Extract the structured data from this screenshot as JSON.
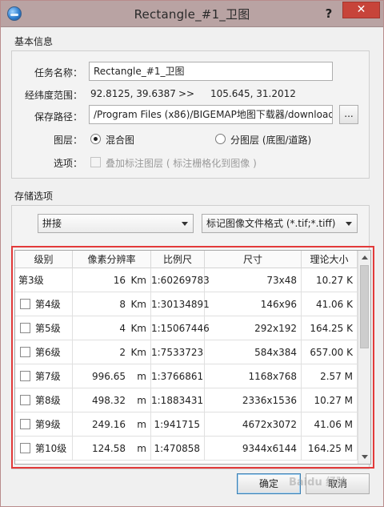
{
  "window": {
    "title": "Rectangle_#1_卫图",
    "help_label": "?",
    "close_label": "✕",
    "icon": "globe-icon"
  },
  "basic_info": {
    "section_label": "基本信息",
    "task_name_label": "任务名称：",
    "task_name_value": "Rectangle_#1_卫图",
    "range_label": "经纬度范围：",
    "range_from": "92.8125, 39.6387",
    "range_arrow": ">>",
    "range_to": "105.645, 31.2012",
    "save_path_label": "保存路径：",
    "save_path_value": "/Program Files (x86)/BIGEMAP地图下载器/download",
    "browse_label": "...",
    "layer_label": "图层：",
    "layer_option_1": "混合图",
    "layer_option_2": "分图层 (底图/道路)",
    "layer_selected": "混合图",
    "options_label": "选项：",
    "overlay_option": "叠加标注图层 ( 标注栅格化到图像 )"
  },
  "storage": {
    "section_label": "存储选项",
    "mode_select": "拼接",
    "format_select": "标记图像文件格式 (*.tif;*.tiff)"
  },
  "table": {
    "headers": [
      "级别",
      "像素分辨率",
      "比例尺",
      "尺寸",
      "理论大小"
    ],
    "rows": [
      {
        "level": "第3级",
        "has_checkbox": false,
        "res_value": "16",
        "res_unit": "Km",
        "scale": "1:60269783",
        "size": "73x48",
        "theory": "10.27 K"
      },
      {
        "level": "第4级",
        "has_checkbox": true,
        "res_value": "8",
        "res_unit": "Km",
        "scale": "1:30134891",
        "size": "146x96",
        "theory": "41.06 K"
      },
      {
        "level": "第5级",
        "has_checkbox": true,
        "res_value": "4",
        "res_unit": "Km",
        "scale": "1:15067446",
        "size": "292x192",
        "theory": "164.25 K"
      },
      {
        "level": "第6级",
        "has_checkbox": true,
        "res_value": "2",
        "res_unit": "Km",
        "scale": "1:7533723",
        "size": "584x384",
        "theory": "657.00 K"
      },
      {
        "level": "第7级",
        "has_checkbox": true,
        "res_value": "996.65",
        "res_unit": "m",
        "scale": "1:3766861",
        "size": "1168x768",
        "theory": "2.57 M"
      },
      {
        "level": "第8级",
        "has_checkbox": true,
        "res_value": "498.32",
        "res_unit": "m",
        "scale": "1:1883431",
        "size": "2336x1536",
        "theory": "10.27 M"
      },
      {
        "level": "第9级",
        "has_checkbox": true,
        "res_value": "249.16",
        "res_unit": "m",
        "scale": "1:941715",
        "size": "4672x3072",
        "theory": "41.06 M"
      },
      {
        "level": "第10级",
        "has_checkbox": true,
        "res_value": "124.58",
        "res_unit": "m",
        "scale": "1:470858",
        "size": "9344x6144",
        "theory": "164.25 M"
      }
    ]
  },
  "footer": {
    "ok_label": "确定",
    "cancel_label": "取消"
  },
  "watermark": "Baidu 经验",
  "colors": {
    "titlebar": "#b9a3a3",
    "close_button": "#c7443a",
    "highlight_border": "#e23a3a"
  }
}
